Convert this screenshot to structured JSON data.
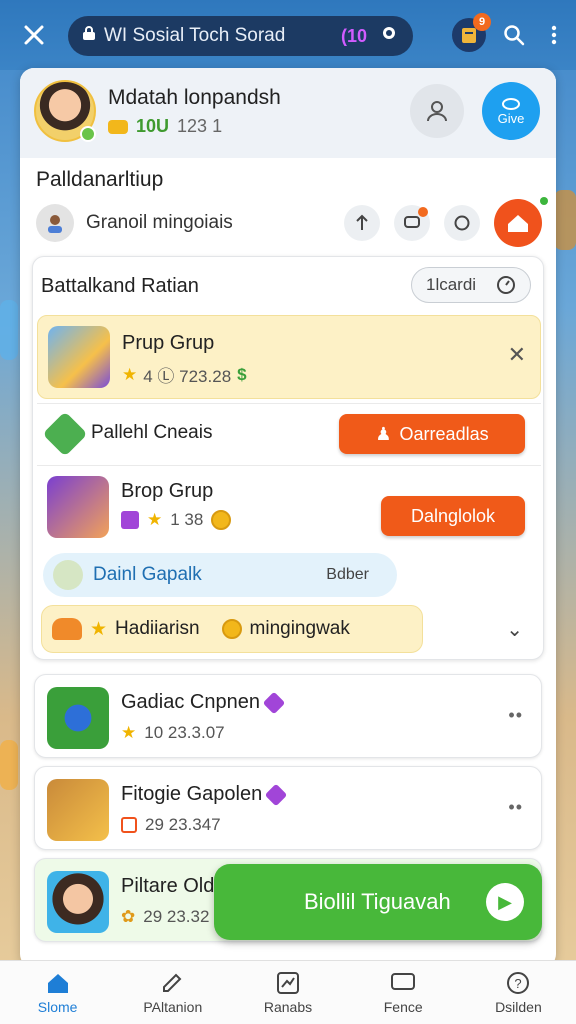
{
  "topbar": {
    "url_text": "WI Sosial Toch Sorad",
    "chip": "(10",
    "ext_count": "9"
  },
  "profile": {
    "name": "Mdatah lonpandsh",
    "score": "10U",
    "level": "123 1",
    "give_label": "Give"
  },
  "section": {
    "title": "Palldanarltiup"
  },
  "friend": {
    "name": "Granoil mingoiais"
  },
  "group_card": {
    "header": "Battalkand Ratian",
    "pill_label": "1lcardi",
    "featured": {
      "title": "Prup Grup",
      "meta": "4 Ⓛ 723.28"
    },
    "sub1": {
      "name": "Pallehl Cneais",
      "button": "Oarreadlas"
    },
    "sub2": {
      "title": "Brop Grup",
      "meta": "1 38",
      "button": "Dalnglolok"
    },
    "blue_pill": {
      "label": "Dainl Gapalk",
      "aux": "Bdber"
    },
    "yellow_pill": {
      "label1": "Hadiiarisn",
      "label2": "mingingwak"
    }
  },
  "list": [
    {
      "title": "Gadiac Cnpnen",
      "meta": "10 23.3.07"
    },
    {
      "title": "Fitogie Gapolen",
      "meta": "29 23.347"
    },
    {
      "title": "Piltare Old",
      "meta": "29 23.32"
    }
  ],
  "cta": {
    "label": "Biollil Tiguavah"
  },
  "nav": [
    {
      "label": "Slome"
    },
    {
      "label": "PAltanion"
    },
    {
      "label": "Ranabs"
    },
    {
      "label": "Fence"
    },
    {
      "label": "Dsilden"
    }
  ]
}
